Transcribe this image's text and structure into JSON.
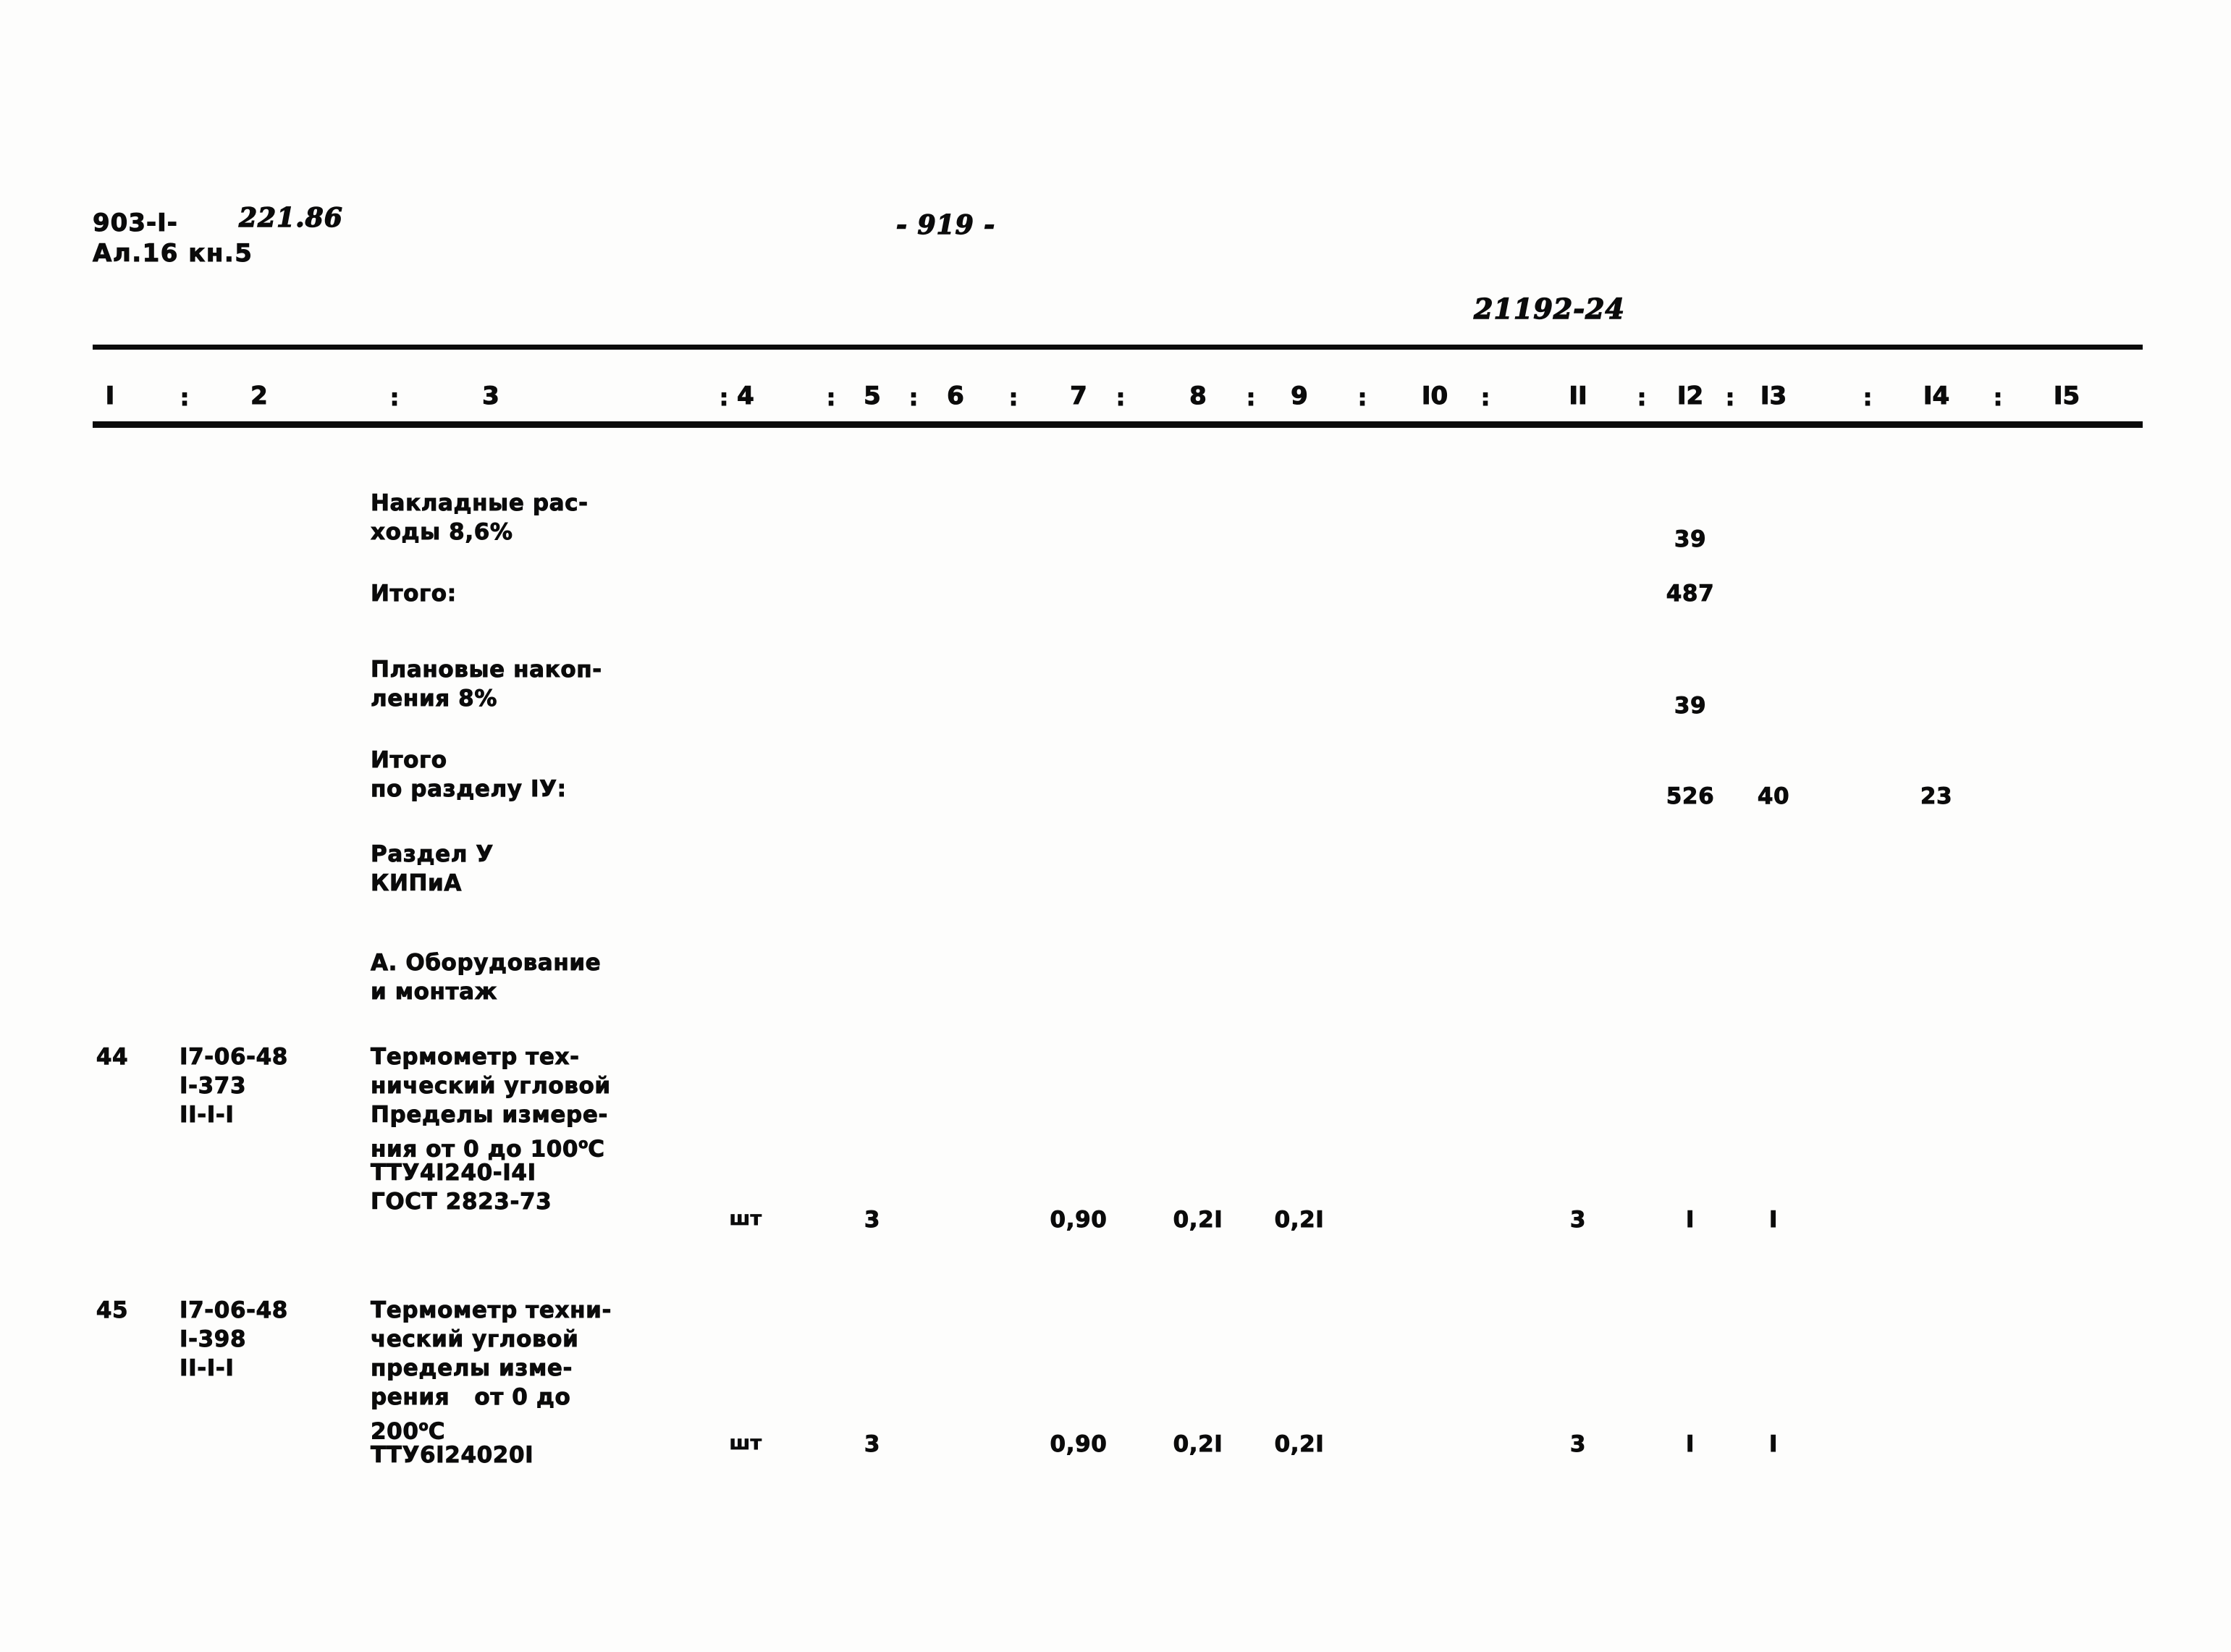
{
  "header": {
    "doc_code_printed": "903-I-",
    "doc_code_hand": "221.86",
    "album_line": "Ал.16 кн.5",
    "page_number": "- 919 -",
    "stamp_number": "21192-24"
  },
  "table": {
    "column_headers": [
      "I",
      "2",
      "3",
      "4",
      "5",
      "6",
      "7",
      "8",
      "9",
      "I0",
      "II",
      "I2",
      "I3",
      "I4",
      "I5"
    ],
    "separator": ":",
    "rows": [
      {
        "name": "overhead-costs",
        "no": "",
        "code": [],
        "description": [
          "Накладные рас-",
          "ходы 8,6%"
        ],
        "unit": "",
        "qty": "",
        "c7": "",
        "c8": "",
        "c9": "",
        "c11": "",
        "c12": "39",
        "c13": "",
        "c14": ""
      },
      {
        "name": "subtotal",
        "no": "",
        "code": [],
        "description": [
          "Итого:"
        ],
        "unit": "",
        "qty": "",
        "c7": "",
        "c8": "",
        "c9": "",
        "c11": "",
        "c12": "487",
        "c13": "",
        "c14": ""
      },
      {
        "name": "planned-savings",
        "no": "",
        "code": [],
        "description": [
          "Плановые накоп-",
          "ления 8%"
        ],
        "unit": "",
        "qty": "",
        "c7": "",
        "c8": "",
        "c9": "",
        "c11": "",
        "c12": "39",
        "c13": "",
        "c14": ""
      },
      {
        "name": "section-4-total",
        "no": "",
        "code": [],
        "description": [
          "Итого",
          "по разделу IУ:"
        ],
        "unit": "",
        "qty": "",
        "c7": "",
        "c8": "",
        "c9": "",
        "c11": "",
        "c12": "526",
        "c13": "40",
        "c14": "23"
      },
      {
        "name": "section-5-heading",
        "no": "",
        "code": [],
        "description": [
          "Раздел У",
          "КИПиА"
        ],
        "unit": "",
        "qty": "",
        "c7": "",
        "c8": "",
        "c9": "",
        "c11": "",
        "c12": "",
        "c13": "",
        "c14": ""
      },
      {
        "name": "subsection-a-heading",
        "no": "",
        "code": [],
        "description": [
          "А. Оборудование",
          "и монтаж"
        ],
        "unit": "",
        "qty": "",
        "c7": "",
        "c8": "",
        "c9": "",
        "c11": "",
        "c12": "",
        "c13": "",
        "c14": ""
      },
      {
        "name": "item-44",
        "no": "44",
        "code": [
          "I7-06-48",
          "I-373",
          "II-I-I"
        ],
        "description": [
          "Термометр тех-",
          "нический угловой",
          "Пределы измере-",
          "ния от 0 до 100°С",
          "ТТУ4I240-I4I",
          "ГОСТ 2823-73"
        ],
        "unit": "шт",
        "qty": "3",
        "c7": "0,90",
        "c8": "0,2I",
        "c9": "0,2I",
        "c11": "3",
        "c12": "I",
        "c13": "I",
        "c14": ""
      },
      {
        "name": "item-45",
        "no": "45",
        "code": [
          "I7-06-48",
          "I-398",
          "II-I-I"
        ],
        "description": [
          "Термометр техни-",
          "ческий угловой",
          "пределы изме-",
          "рения   от 0 до",
          "200°С",
          "ТТУ6I24020I"
        ],
        "unit": "шт",
        "qty": "3",
        "c7": "0,90",
        "c8": "0,2I",
        "c9": "0,2I",
        "c11": "3",
        "c12": "I",
        "c13": "I",
        "c14": ""
      }
    ]
  }
}
